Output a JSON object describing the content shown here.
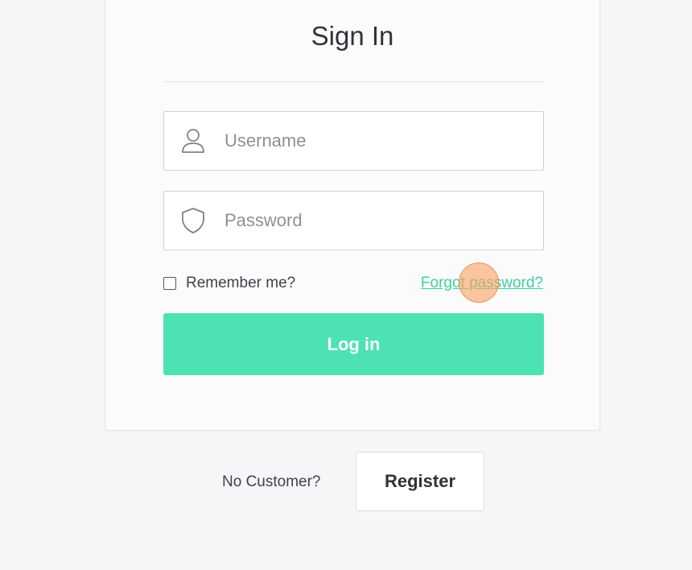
{
  "form": {
    "title": "Sign In",
    "username": {
      "placeholder": "Username",
      "value": ""
    },
    "password": {
      "placeholder": "Password",
      "value": ""
    },
    "remember_label": "Remember me?",
    "remember_checked": false,
    "forgot_label": "Forgot password?",
    "login_label": "Log in"
  },
  "footer": {
    "no_customer_label": "No Customer?",
    "register_label": "Register"
  },
  "icons": {
    "username": "user-icon",
    "password": "shield-icon"
  },
  "colors": {
    "accent": "#4de2b3",
    "link": "#3fcf9f",
    "background": "#f5f6f8",
    "card": "#fbfbfc"
  }
}
